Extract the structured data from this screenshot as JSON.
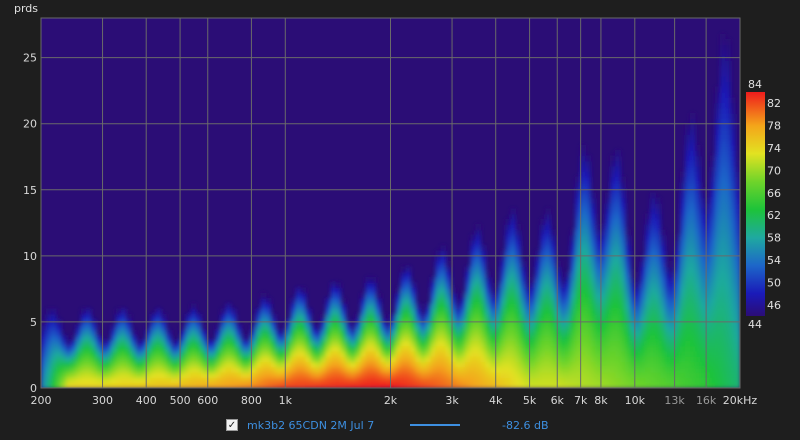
{
  "chart_data": {
    "type": "heatmap",
    "title": "",
    "ylabel": "prds",
    "xlabel": "",
    "x_scale": "log",
    "xlim": [
      200,
      20000
    ],
    "ylim": [
      0,
      28
    ],
    "x_ticks": [
      {
        "value": 200,
        "label": "200"
      },
      {
        "value": 300,
        "label": "300"
      },
      {
        "value": 400,
        "label": "400"
      },
      {
        "value": 500,
        "label": "500"
      },
      {
        "value": 600,
        "label": "600"
      },
      {
        "value": 800,
        "label": "800"
      },
      {
        "value": 1000,
        "label": "1k"
      },
      {
        "value": 2000,
        "label": "2k"
      },
      {
        "value": 3000,
        "label": "3k"
      },
      {
        "value": 4000,
        "label": "4k"
      },
      {
        "value": 5000,
        "label": "5k"
      },
      {
        "value": 6000,
        "label": "6k"
      },
      {
        "value": 7000,
        "label": "7k"
      },
      {
        "value": 8000,
        "label": "8k"
      },
      {
        "value": 10000,
        "label": "10k"
      },
      {
        "value": 13000,
        "label": "13k",
        "dim": true
      },
      {
        "value": 16000,
        "label": "16k",
        "dim": true
      },
      {
        "value": 20000,
        "label": "20kHz"
      }
    ],
    "y_ticks": [
      0,
      5,
      10,
      15,
      20,
      25
    ],
    "colorbar": {
      "min": 44,
      "max": 84,
      "ticks": [
        84,
        82,
        78,
        74,
        70,
        66,
        62,
        58,
        54,
        50,
        46,
        44
      ],
      "stops": [
        {
          "value": 44,
          "color": "#2b0d76"
        },
        {
          "value": 48,
          "color": "#1a1ab8"
        },
        {
          "value": 53,
          "color": "#1d66c9"
        },
        {
          "value": 58,
          "color": "#1fa9a0"
        },
        {
          "value": 63,
          "color": "#1dc33a"
        },
        {
          "value": 68,
          "color": "#6fd42a"
        },
        {
          "value": 73,
          "color": "#e2e221"
        },
        {
          "value": 78,
          "color": "#f4a51a"
        },
        {
          "value": 84,
          "color": "#ee1c1c"
        }
      ]
    },
    "grid": true,
    "background_color": "#2b0d76",
    "series": [
      {
        "name": "mk3b2 65CDN 2M Jul 7",
        "ridge_peaks": [
          {
            "freq": 300,
            "base_db": 74,
            "decay_periods": 6.0
          },
          {
            "freq": 500,
            "base_db": 76,
            "decay_periods": 6.0
          },
          {
            "freq": 800,
            "base_db": 79,
            "decay_periods": 6.5
          },
          {
            "freq": 1000,
            "base_db": 82,
            "decay_periods": 7.5
          },
          {
            "freq": 1400,
            "base_db": 83,
            "decay_periods": 8.0
          },
          {
            "freq": 2000,
            "base_db": 84,
            "decay_periods": 8.5
          },
          {
            "freq": 2500,
            "base_db": 82,
            "decay_periods": 10.0
          },
          {
            "freq": 3000,
            "base_db": 80,
            "decay_periods": 11.0
          },
          {
            "freq": 4000,
            "base_db": 76,
            "decay_periods": 13.0
          },
          {
            "freq": 5000,
            "base_db": 72,
            "decay_periods": 14.0
          },
          {
            "freq": 6000,
            "base_db": 72,
            "decay_periods": 13.0
          },
          {
            "freq": 8000,
            "base_db": 70,
            "decay_periods": 22.0
          },
          {
            "freq": 10000,
            "base_db": 68,
            "decay_periods": 14.0
          },
          {
            "freq": 13000,
            "base_db": 66,
            "decay_periods": 16.0
          },
          {
            "freq": 16000,
            "base_db": 64,
            "decay_periods": 26.0
          },
          {
            "freq": 20000,
            "base_db": 60,
            "decay_periods": 28.0
          }
        ]
      }
    ],
    "legend": {
      "checked": true,
      "entries": [
        {
          "name": "mk3b2 65CDN 2M Jul 7",
          "value": "-82.6 dB",
          "color": "#3d8fe0"
        }
      ]
    }
  }
}
